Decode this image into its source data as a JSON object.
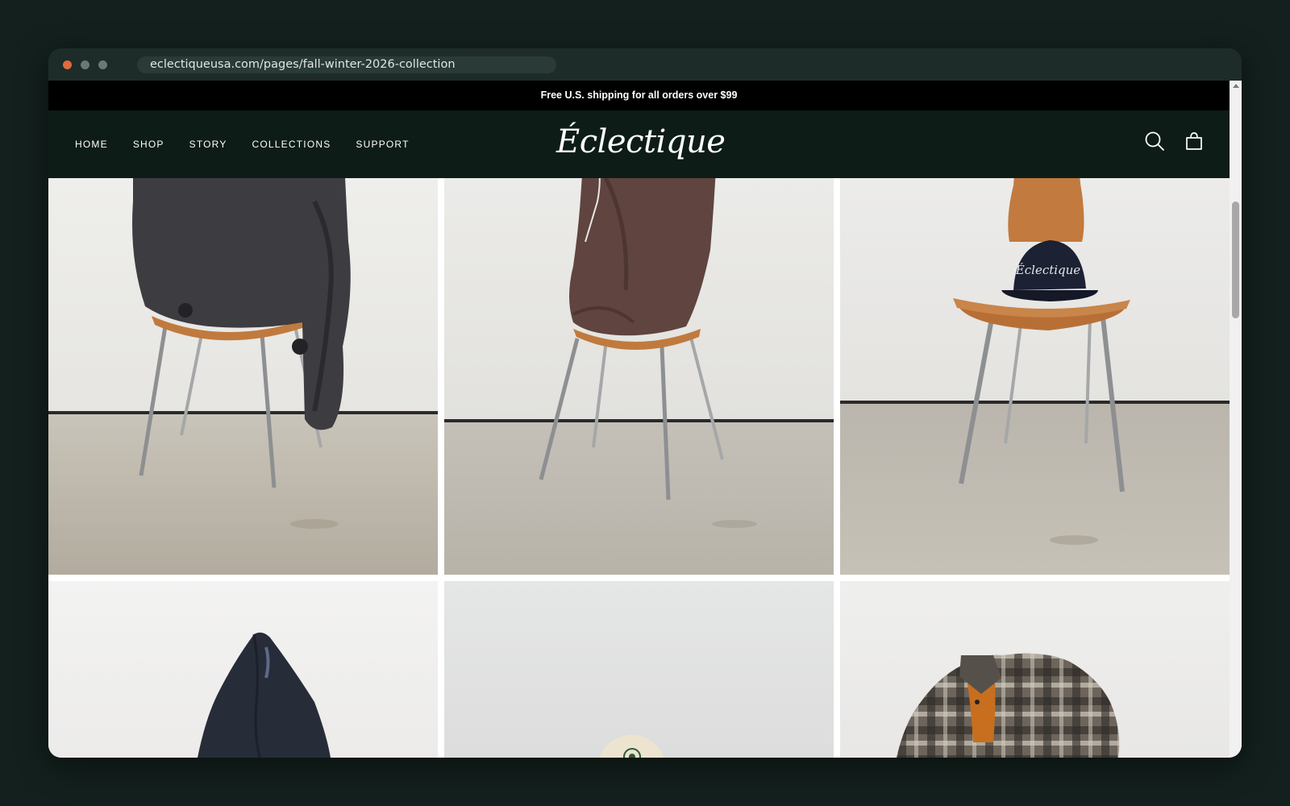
{
  "browser": {
    "url": "eclectiqueusa.com/pages/fall-winter-2026-collection"
  },
  "announcement": "Free U.S. shipping for all orders over $99",
  "header": {
    "nav": [
      "HOME",
      "SHOP",
      "STORY",
      "COLLECTIONS",
      "SUPPORT"
    ],
    "logo": "Éclectique",
    "icons": [
      "search-icon",
      "bag-icon"
    ]
  },
  "gallery": {
    "tiles": [
      {
        "subject": "knit-jacket-on-chair"
      },
      {
        "subject": "brown-jacket-on-chair"
      },
      {
        "subject": "navy-cap-on-chair"
      },
      {
        "subject": "navy-blazer"
      },
      {
        "subject": "cream-cap-on-stool"
      },
      {
        "subject": "plaid-shirt"
      }
    ]
  },
  "colors": {
    "header_bg": "#0e1c17",
    "announcement_bg": "#000000",
    "page_bg": "#13201d"
  }
}
